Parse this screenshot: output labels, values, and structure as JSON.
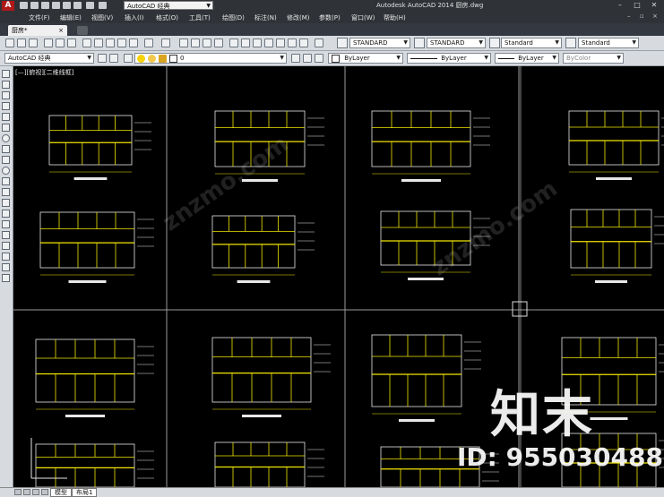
{
  "titlebar": {
    "workspace": "AutoCAD 经典",
    "title": "Autodesk AutoCAD 2014   厨房.dwg",
    "logo": "A",
    "minimize": "–",
    "maximize": "□",
    "close": "✕"
  },
  "menu": {
    "items": [
      "文件(F)",
      "编辑(E)",
      "视图(V)",
      "插入(I)",
      "格式(O)",
      "工具(T)",
      "绘图(D)",
      "标注(N)",
      "修改(M)",
      "参数(P)",
      "窗口(W)",
      "帮助(H)"
    ]
  },
  "tabs": {
    "file_tab": "厨房*",
    "file_tab_close": "×"
  },
  "toolbar1": {
    "text_style": "STANDARD",
    "dim_style": "STANDARD",
    "table_style": "Standard",
    "multileader_style": "Standard"
  },
  "toolbar2": {
    "workspace": "AutoCAD 经典",
    "layer": "0",
    "color": "ByLayer",
    "linetype": "ByLayer",
    "lineweight": "ByLayer",
    "plotstyle": "ByColor"
  },
  "canvas": {
    "viewport_label": "[—][俯视][二维线框]"
  },
  "status": {
    "model_tab": "模型",
    "layout_tab": "布局1"
  },
  "watermark": {
    "logo": "知末",
    "id": "ID: 955030488",
    "diagonal": "znzmo.com"
  },
  "colors": {
    "chrome_dark": "#2f3338",
    "toolbar_bg": "#d7dbe0",
    "canvas_bg": "#000000",
    "drawing_yellow": "#f2e600",
    "drawing_white": "#e8e8e8",
    "autocad_red": "#b01818"
  }
}
